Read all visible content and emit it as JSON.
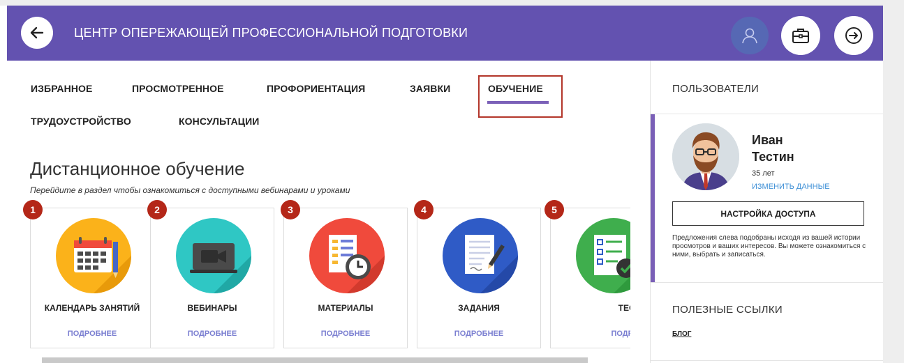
{
  "header": {
    "title": "ЦЕНТР ОПЕРЕЖАЮЩЕЙ ПРОФЕССИОНАЛЬНОЙ ПОДГОТОВКИ",
    "back_icon": "arrow-left-icon",
    "user_icon": "user-icon",
    "case_icon": "briefcase-icon",
    "exit_icon": "exit-icon",
    "color": "#6352b0"
  },
  "tabs": [
    {
      "label": "ИЗБРАННОЕ"
    },
    {
      "label": "ПРОСМОТРЕННОЕ"
    },
    {
      "label": "ПРОФОРИЕНТАЦИЯ"
    },
    {
      "label": "ЗАЯВКИ"
    },
    {
      "label": "ОБУЧЕНИЕ",
      "active": true
    },
    {
      "label": "ТРУДОУСТРОЙСТВО"
    },
    {
      "label": "КОНСУЛЬТАЦИИ"
    }
  ],
  "section": {
    "title": "Дистанционное обучение",
    "subtitle": "Перейдите в раздел чтобы ознакомиться с доступными вебинарами и уроками"
  },
  "cards": [
    {
      "num": "1",
      "label": "КАЛЕНДАРЬ ЗАНЯТИЙ",
      "more": "ПОДРОБНЕЕ",
      "icon": "calendar-icon",
      "color": "#fbb21a"
    },
    {
      "num": "2",
      "label": "ВЕБИНАРЫ",
      "more": "ПОДРОБНЕЕ",
      "icon": "video-camera-icon",
      "color": "#2fc7c4"
    },
    {
      "num": "3",
      "label": "МАТЕРИАЛЫ",
      "more": "ПОДРОБНЕЕ",
      "icon": "document-clock-icon",
      "color": "#f04a3c"
    },
    {
      "num": "4",
      "label": "ЗАДАНИЯ",
      "more": "ПОДРОБНЕЕ",
      "icon": "document-pen-icon",
      "color": "#2f5bc6"
    },
    {
      "num": "5",
      "label": "ТЕСТЫ",
      "more": "ПОДРОБНЕ",
      "icon": "checklist-icon",
      "color": "#3fae4d"
    }
  ],
  "sidebar": {
    "users_title": "ПОЛЬЗОВАТЕЛИ",
    "name_first": "Иван",
    "name_last": "Тестин",
    "age": "35 лет",
    "edit": "ИЗМЕНИТЬ ДАННЫЕ",
    "access_button": "НАСТРОЙКА ДОСТУПА",
    "note": "Предложения слева подобраны исходя из вашей истории просмотров и ваших интересов. Вы можете ознакомиться с ними, выбрать и записаться.",
    "links_title": "ПОЛЕЗНЫЕ ССЫЛКИ",
    "blog": "БЛОГ"
  }
}
